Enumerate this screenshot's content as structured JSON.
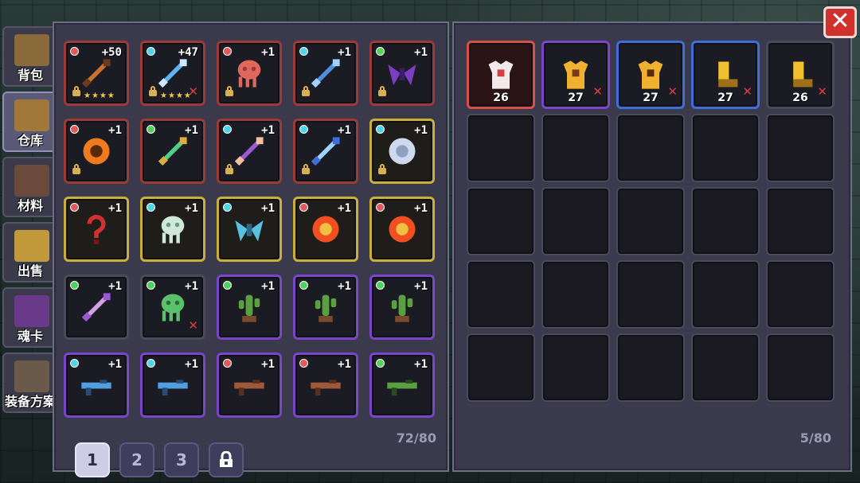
{
  "tabs": [
    {
      "label": "背包",
      "icon": "backpack-icon",
      "active": false
    },
    {
      "label": "仓库",
      "icon": "chest-icon",
      "active": true
    },
    {
      "label": "材料",
      "icon": "materials-icon",
      "active": false
    },
    {
      "label": "出售",
      "icon": "coins-icon",
      "active": false
    },
    {
      "label": "魂卡",
      "icon": "soul-card-icon",
      "active": false
    },
    {
      "label": "装备方案",
      "icon": "armor-set-icon",
      "active": false
    }
  ],
  "storage": {
    "items": [
      {
        "name": "flame-blade-icon",
        "plus": "+50",
        "rarity": "red",
        "gem": "red",
        "lock": true,
        "stars": "★★★★",
        "remove": false
      },
      {
        "name": "ice-bow-icon",
        "plus": "+47",
        "rarity": "red",
        "gem": "cyan",
        "lock": true,
        "stars": "★★★★",
        "remove": true
      },
      {
        "name": "octopus-icon",
        "plus": "+1",
        "rarity": "red",
        "gem": "red",
        "lock": true,
        "stars": "",
        "remove": false
      },
      {
        "name": "cross-staff-icon",
        "plus": "+1",
        "rarity": "red",
        "gem": "cyan",
        "lock": true,
        "stars": "",
        "remove": false
      },
      {
        "name": "bat-wings-icon",
        "plus": "+1",
        "rarity": "red",
        "gem": "green",
        "lock": true,
        "stars": "",
        "remove": false
      },
      {
        "name": "pumpkin-icon",
        "plus": "+1",
        "rarity": "red",
        "gem": "red",
        "lock": true,
        "stars": "",
        "remove": false
      },
      {
        "name": "green-sword-icon",
        "plus": "+1",
        "rarity": "red",
        "gem": "green",
        "lock": false,
        "stars": "",
        "remove": false
      },
      {
        "name": "girl-spear-icon",
        "plus": "+1",
        "rarity": "red",
        "gem": "cyan",
        "lock": true,
        "stars": "",
        "remove": false
      },
      {
        "name": "ice-staff-icon",
        "plus": "+1",
        "rarity": "red",
        "gem": "cyan",
        "lock": true,
        "stars": "",
        "remove": false
      },
      {
        "name": "moon-orb-icon",
        "plus": "+1",
        "rarity": "gold",
        "gem": "cyan",
        "lock": true,
        "stars": "",
        "remove": false
      },
      {
        "name": "question-hook-icon",
        "plus": "+1",
        "rarity": "gold",
        "gem": "red",
        "lock": false,
        "stars": "",
        "remove": false
      },
      {
        "name": "ghost-jaw-icon",
        "plus": "+1",
        "rarity": "gold",
        "gem": "cyan",
        "lock": false,
        "stars": "",
        "remove": false
      },
      {
        "name": "crystal-icon",
        "plus": "+1",
        "rarity": "gold",
        "gem": "cyan",
        "lock": false,
        "stars": "",
        "remove": false
      },
      {
        "name": "sun-orb-icon",
        "plus": "+1",
        "rarity": "gold",
        "gem": "red",
        "lock": false,
        "stars": "",
        "remove": false
      },
      {
        "name": "sun-orb-icon",
        "plus": "+1",
        "rarity": "gold",
        "gem": "red",
        "lock": false,
        "stars": "",
        "remove": false
      },
      {
        "name": "scythe-icon",
        "plus": "+1",
        "rarity": "gray",
        "gem": "green",
        "lock": false,
        "stars": "",
        "remove": false
      },
      {
        "name": "skeleton-frog-icon",
        "plus": "+1",
        "rarity": "gray",
        "gem": "green",
        "lock": false,
        "stars": "",
        "remove": true
      },
      {
        "name": "cactus-icon",
        "plus": "+1",
        "rarity": "purple",
        "gem": "green",
        "lock": false,
        "stars": "",
        "remove": false
      },
      {
        "name": "cactus-icon",
        "plus": "+1",
        "rarity": "purple",
        "gem": "green",
        "lock": false,
        "stars": "",
        "remove": false
      },
      {
        "name": "cactus-icon",
        "plus": "+1",
        "rarity": "purple",
        "gem": "green",
        "lock": false,
        "stars": "",
        "remove": false
      },
      {
        "name": "blue-rifle-icon",
        "plus": "+1",
        "rarity": "purple",
        "gem": "cyan",
        "lock": false,
        "stars": "",
        "remove": false
      },
      {
        "name": "blue-rifle-icon",
        "plus": "+1",
        "rarity": "purple",
        "gem": "cyan",
        "lock": false,
        "stars": "",
        "remove": false
      },
      {
        "name": "brown-gun-icon",
        "plus": "+1",
        "rarity": "purple",
        "gem": "red",
        "lock": false,
        "stars": "",
        "remove": false
      },
      {
        "name": "brown-gun-icon",
        "plus": "+1",
        "rarity": "purple",
        "gem": "red",
        "lock": false,
        "stars": "",
        "remove": false
      },
      {
        "name": "green-gun-icon",
        "plus": "+1",
        "rarity": "purple",
        "gem": "green",
        "lock": false,
        "stars": "",
        "remove": false
      }
    ],
    "pages": [
      "1",
      "2",
      "3"
    ],
    "active_page": "1",
    "lock_icon": "padlock-icon",
    "count": "72/80"
  },
  "equipment": {
    "items": [
      {
        "name": "white-robe-icon",
        "level": "26",
        "rarity": "red2",
        "remove": false
      },
      {
        "name": "gold-horn-armor-icon",
        "level": "27",
        "rarity": "purple",
        "remove": true
      },
      {
        "name": "spiked-armor-icon",
        "level": "27",
        "rarity": "blue",
        "remove": true
      },
      {
        "name": "gold-boots-icon",
        "level": "27",
        "rarity": "blue",
        "remove": true
      },
      {
        "name": "gold-boots-icon",
        "level": "26",
        "rarity": "gray",
        "remove": true
      }
    ],
    "count": "5/80"
  },
  "colors": {
    "accent_red": "#d0312d",
    "gold": "#c9b03a",
    "purple": "#7a45c6",
    "blue": "#3e6ed6"
  }
}
